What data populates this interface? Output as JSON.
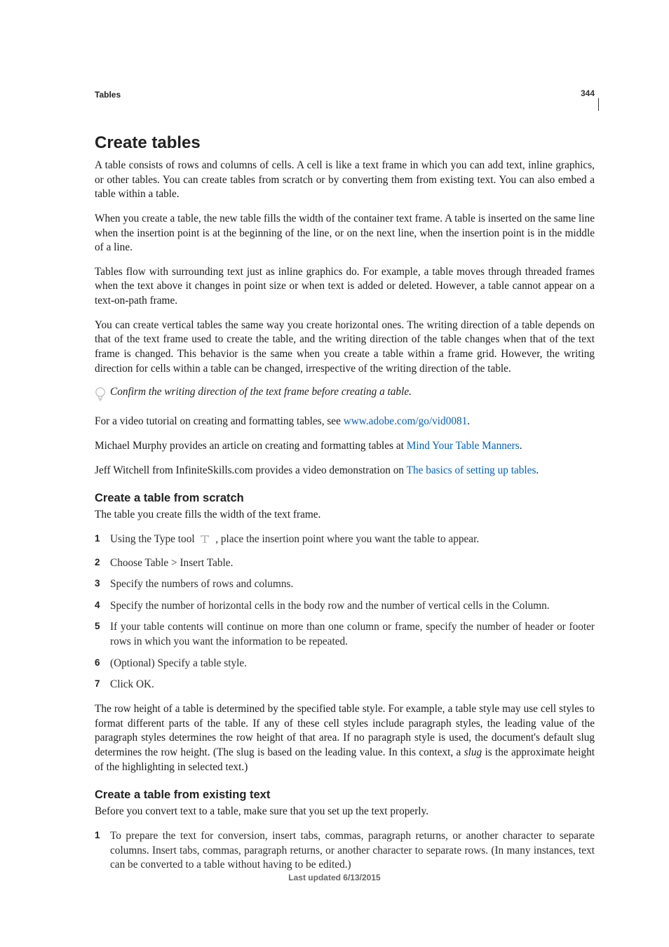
{
  "page_number": "344",
  "section_header": "Tables",
  "title": "Create tables",
  "intro": {
    "p1": "A table consists of rows and columns of cells. A cell is like a text frame in which you can add text, inline graphics, or other tables. You can create tables from scratch or by converting them from existing text. You can also embed a table within a table.",
    "p2": "When you create a table, the new table fills the width of the container text frame. A table is inserted on the same line when the insertion point is at the beginning of the line, or on the next line, when the insertion point is in the middle of a line.",
    "p3": "Tables flow with surrounding text just as inline graphics do. For example, a table moves through threaded frames when the text above it changes in point size or when text is added or deleted. However, a table cannot appear on a text-on-path frame.",
    "p4": "You can create vertical tables the same way you create horizontal ones. The writing direction of a table depends on that of the text frame used to create the table, and the writing direction of the table changes when that of the text frame is changed. This behavior is the same when you create a table within a frame grid. However, the writing direction for cells within a table can be changed, irrespective of the writing direction of the table."
  },
  "tip": "Confirm the writing direction of the text frame before creating a table.",
  "refs": {
    "video_intro": "For a video tutorial on creating and formatting tables, see ",
    "video_link": "www.adobe.com/go/vid0081",
    "video_end": ".",
    "murphy_intro": "Michael Murphy provides an article on creating and formatting tables at ",
    "murphy_link": "Mind Your Table Manners",
    "murphy_end": ".",
    "witchell_intro": "Jeff Witchell from InfiniteSkills.com provides a video demonstration on ",
    "witchell_link": "The basics of setting up tables",
    "witchell_end": "."
  },
  "scratch": {
    "heading": "Create a table from scratch",
    "intro": "The table you create fills the width of the text frame.",
    "steps": {
      "s1a": "Using the Type tool  ",
      "s1b": " , place the insertion point where you want the table to appear.",
      "s2": "Choose Table > Insert Table.",
      "s3": "Specify the numbers of rows and columns.",
      "s4": "Specify the number of horizontal cells in the body row and the number of vertical cells in the Column.",
      "s5": "If your table contents will continue on more than one column or frame, specify the number of header or footer rows in which you want the information to be repeated.",
      "s6": "(Optional) Specify a table style.",
      "s7": "Click OK."
    },
    "after_a": "The row height of a table is determined by the specified table style. For example, a table style may use cell styles to format different parts of the table. If any of these cell styles include paragraph styles, the leading value of the paragraph styles determines the row height of that area. If no paragraph style is used, the document's default slug determines the row height. (The slug is based on the leading value. In this context, a ",
    "after_italic": "slug",
    "after_b": " is the approximate height of the highlighting in selected text.)"
  },
  "existing": {
    "heading": "Create a table from existing text",
    "intro": "Before you convert text to a table, make sure that you set up the text properly.",
    "steps": {
      "s1": "To prepare the text for conversion, insert tabs, commas, paragraph returns, or another character to separate columns. Insert tabs, commas, paragraph returns, or another character to separate rows. (In many instances, text can be converted to a table without having to be edited.)"
    }
  },
  "footer": "Last updated 6/13/2015"
}
